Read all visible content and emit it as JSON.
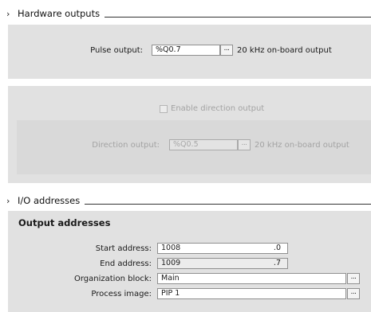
{
  "hardware_outputs": {
    "title": "Hardware outputs",
    "pulse_output": {
      "label": "Pulse output:",
      "value": "%Q0.7",
      "browse": "...",
      "description": "20 kHz on-board output"
    },
    "enable_direction": {
      "label": "Enable direction output",
      "checked": false
    },
    "direction_output": {
      "label": "Direction output:",
      "value": "%Q0.5",
      "browse": "...",
      "description": "20 kHz on-board output"
    }
  },
  "io_addresses": {
    "title": "I/O addresses",
    "subtitle": "Output addresses",
    "start_address": {
      "label": "Start address:",
      "value": "1008",
      "bit": ".0"
    },
    "end_address": {
      "label": "End address:",
      "value": "1009",
      "bit": ".7"
    },
    "organization_block": {
      "label": "Organization block:",
      "value": "Main",
      "browse": "..."
    },
    "process_image": {
      "label": "Process image:",
      "value": "PIP 1",
      "browse": "..."
    }
  }
}
